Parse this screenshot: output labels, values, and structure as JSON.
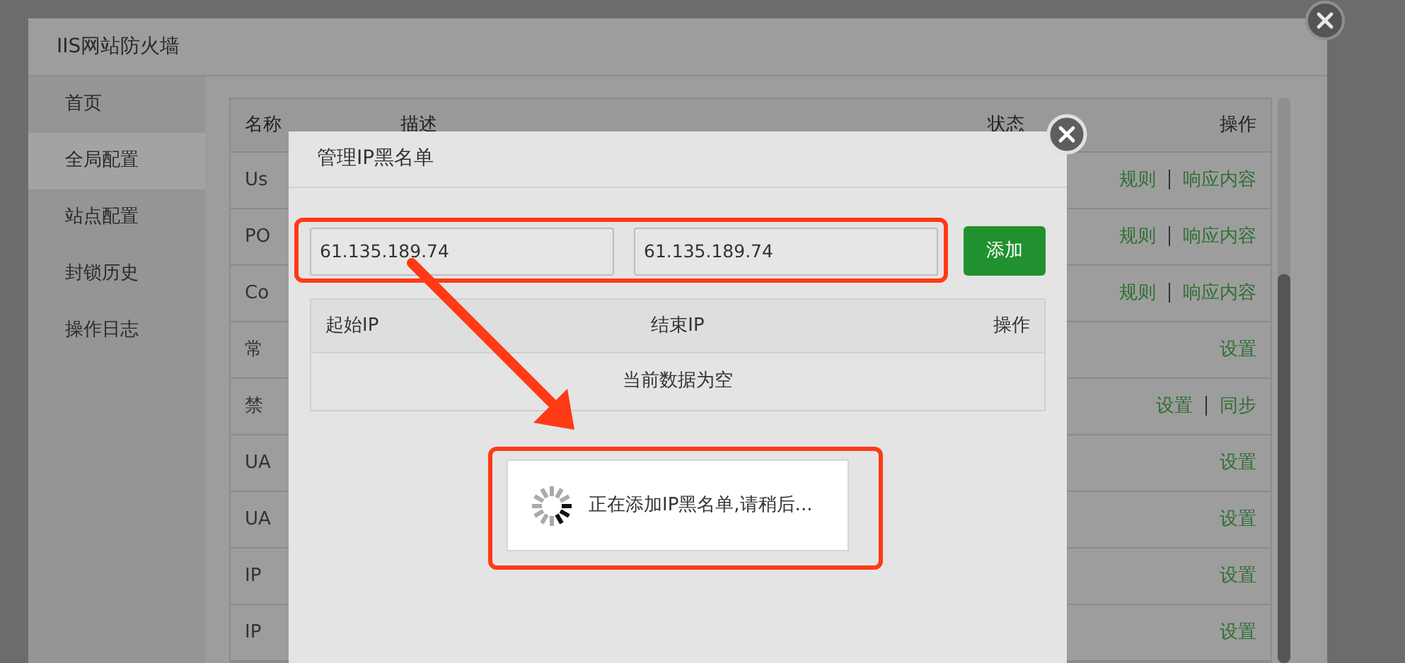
{
  "window": {
    "title": "IIS网站防火墙"
  },
  "sidebar": {
    "items": [
      {
        "label": "首页",
        "selected": false
      },
      {
        "label": "全局配置",
        "selected": true
      },
      {
        "label": "站点配置",
        "selected": false
      },
      {
        "label": "封锁历史",
        "selected": false
      },
      {
        "label": "操作日志",
        "selected": false
      }
    ]
  },
  "rules_table": {
    "columns": [
      "名称",
      "描述",
      "状态",
      "操作"
    ],
    "rows": [
      {
        "name": "Us",
        "actions": [
          "规则",
          "响应内容"
        ]
      },
      {
        "name": "PO",
        "actions": [
          "规则",
          "响应内容"
        ]
      },
      {
        "name": "Co",
        "actions": [
          "规则",
          "响应内容"
        ]
      },
      {
        "name": "常",
        "actions": [
          "设置"
        ]
      },
      {
        "name": "禁",
        "actions": [
          "设置",
          "同步"
        ]
      },
      {
        "name": "UA",
        "actions": [
          "设置"
        ]
      },
      {
        "name": "UA",
        "actions": [
          "设置"
        ]
      },
      {
        "name": "IP",
        "actions": [
          "设置"
        ]
      },
      {
        "name": "IP",
        "actions": [
          "设置"
        ]
      }
    ]
  },
  "dialog": {
    "title": "管理IP黑名单",
    "start_ip": {
      "value": "61.135.189.74"
    },
    "end_ip": {
      "value": "61.135.189.74"
    },
    "add_button": "添加",
    "table": {
      "columns": [
        "起始IP",
        "结束IP",
        "操作"
      ],
      "empty_text": "当前数据为空"
    }
  },
  "loading": {
    "text": "正在添加IP黑名单,请稍后..."
  }
}
